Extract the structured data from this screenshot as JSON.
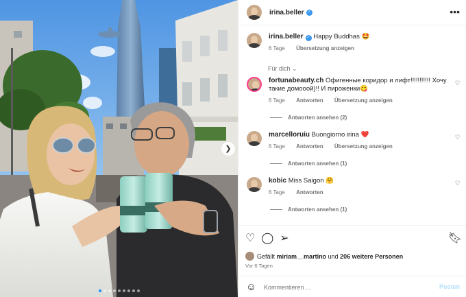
{
  "post": {
    "username": "irina.beller",
    "more_icon": "more-horizontal-icon"
  },
  "caption": {
    "username": "irina.beller",
    "text": "Happy Buddhas",
    "emoji": "🤩",
    "age": "6 Tage",
    "translate": "Übersetzung anzeigen"
  },
  "for_you": "Für dich",
  "comments": [
    {
      "username": "fortunabeauty.ch",
      "text": "Офигенные коридор и лифт!!!!!!!!!!! Хочу такие домооой)!! И пироженки",
      "emoji": "😋",
      "age": "6 Tage",
      "reply": "Antworten",
      "translate": "Übersetzung anzeigen",
      "view_replies": "Antworten ansehen (2)"
    },
    {
      "username": "marcelloruiu",
      "text": "Buongiorno irina",
      "emoji": "❤️",
      "age": "6 Tage",
      "reply": "Antworten",
      "translate": "Übersetzung anzeigen",
      "view_replies": "Antworten ansehen (1)"
    },
    {
      "username": "kobic",
      "text": "Miss Saigon",
      "emoji": "🤗",
      "age": "6 Tage",
      "reply": "Antworten",
      "translate": "",
      "view_replies": "Antworten ansehen (1)"
    }
  ],
  "likes": {
    "prefix": "Gefällt",
    "user": "miriam__martino",
    "middle": "und",
    "others": "206 weitere Personen"
  },
  "post_age": "Vor 6 Tagen",
  "composer": {
    "placeholder": "Kommentieren ...",
    "post_label": "Posten"
  },
  "carousel": {
    "slides": 9,
    "active_index": 0
  },
  "colors": {
    "verified": "#3897f0",
    "heart_red": "#ed4956",
    "post_button": "#b2dffc",
    "muted_text": "#737373"
  }
}
